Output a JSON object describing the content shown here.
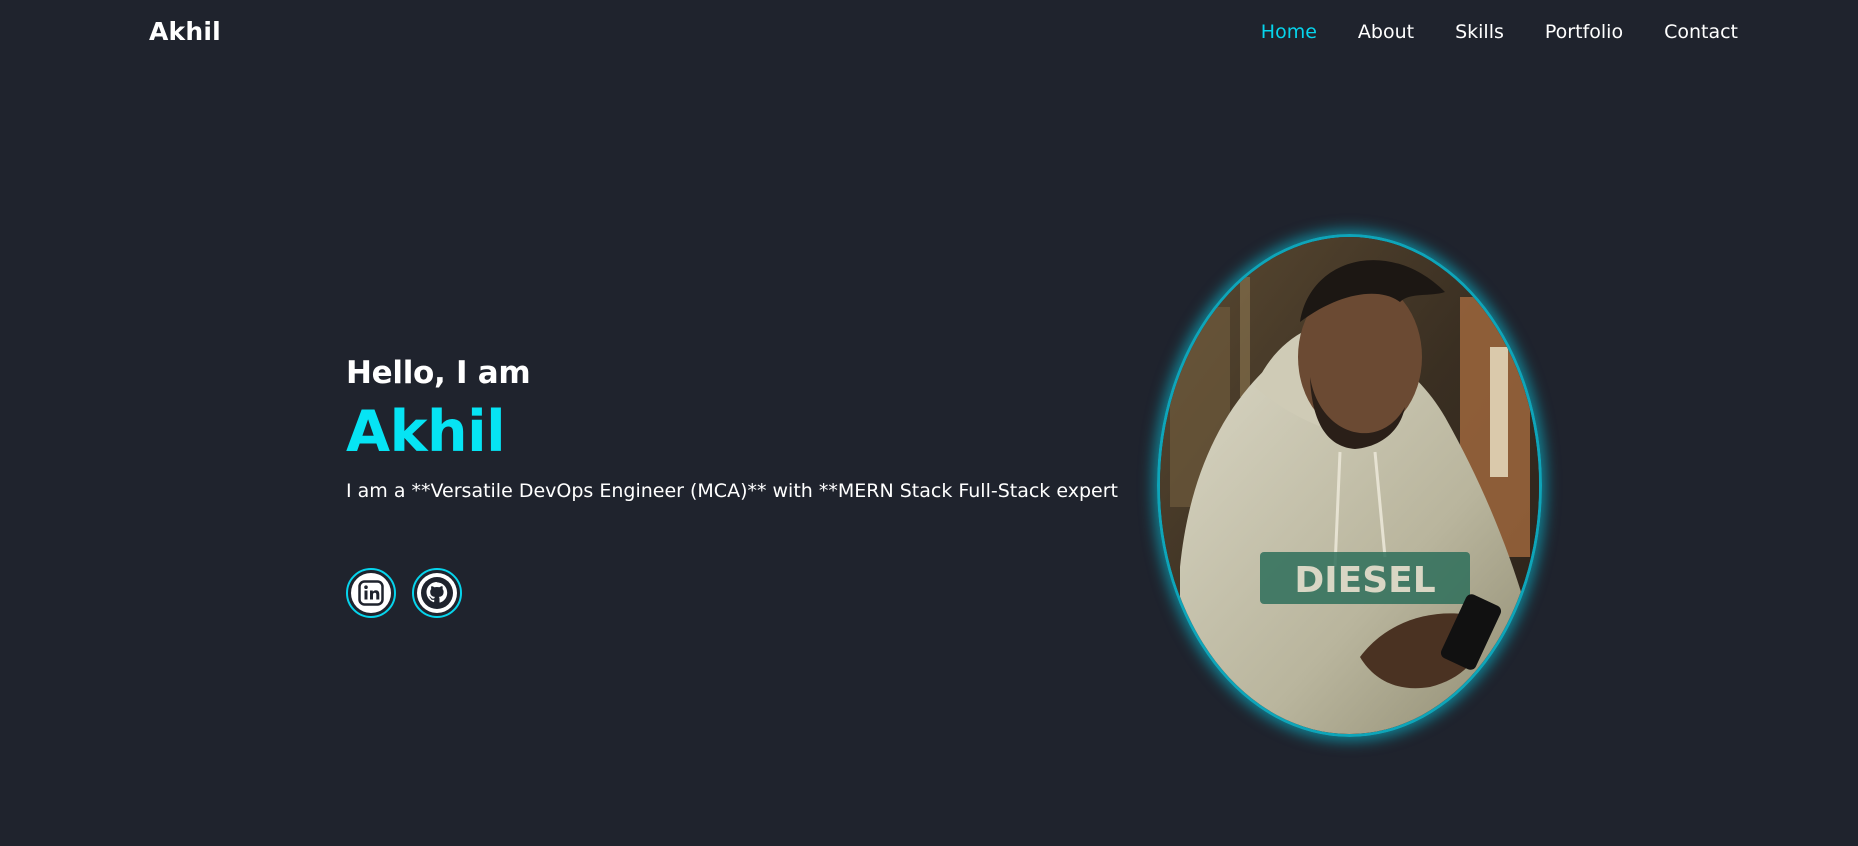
{
  "header": {
    "logo": "Akhil",
    "nav": [
      {
        "label": "Home",
        "active": true
      },
      {
        "label": "About",
        "active": false
      },
      {
        "label": "Skills",
        "active": false
      },
      {
        "label": "Portfolio",
        "active": false
      },
      {
        "label": "Contact",
        "active": false
      }
    ]
  },
  "hero": {
    "greeting": "Hello, I am",
    "name": "Akhil",
    "tagline": "I am a **Versatile DevOps Engineer (MCA)** with **MERN Stack Full-Stack expert"
  },
  "socials": [
    {
      "icon": "linkedin-icon"
    },
    {
      "icon": "github-icon"
    }
  ],
  "portrait": {
    "icon": "profile-photo",
    "shirt_text": "DIESEL"
  },
  "colors": {
    "background": "#1f232d",
    "accent": "#06e4f4",
    "nav_active": "#06d4ec",
    "text": "#ffffff"
  }
}
